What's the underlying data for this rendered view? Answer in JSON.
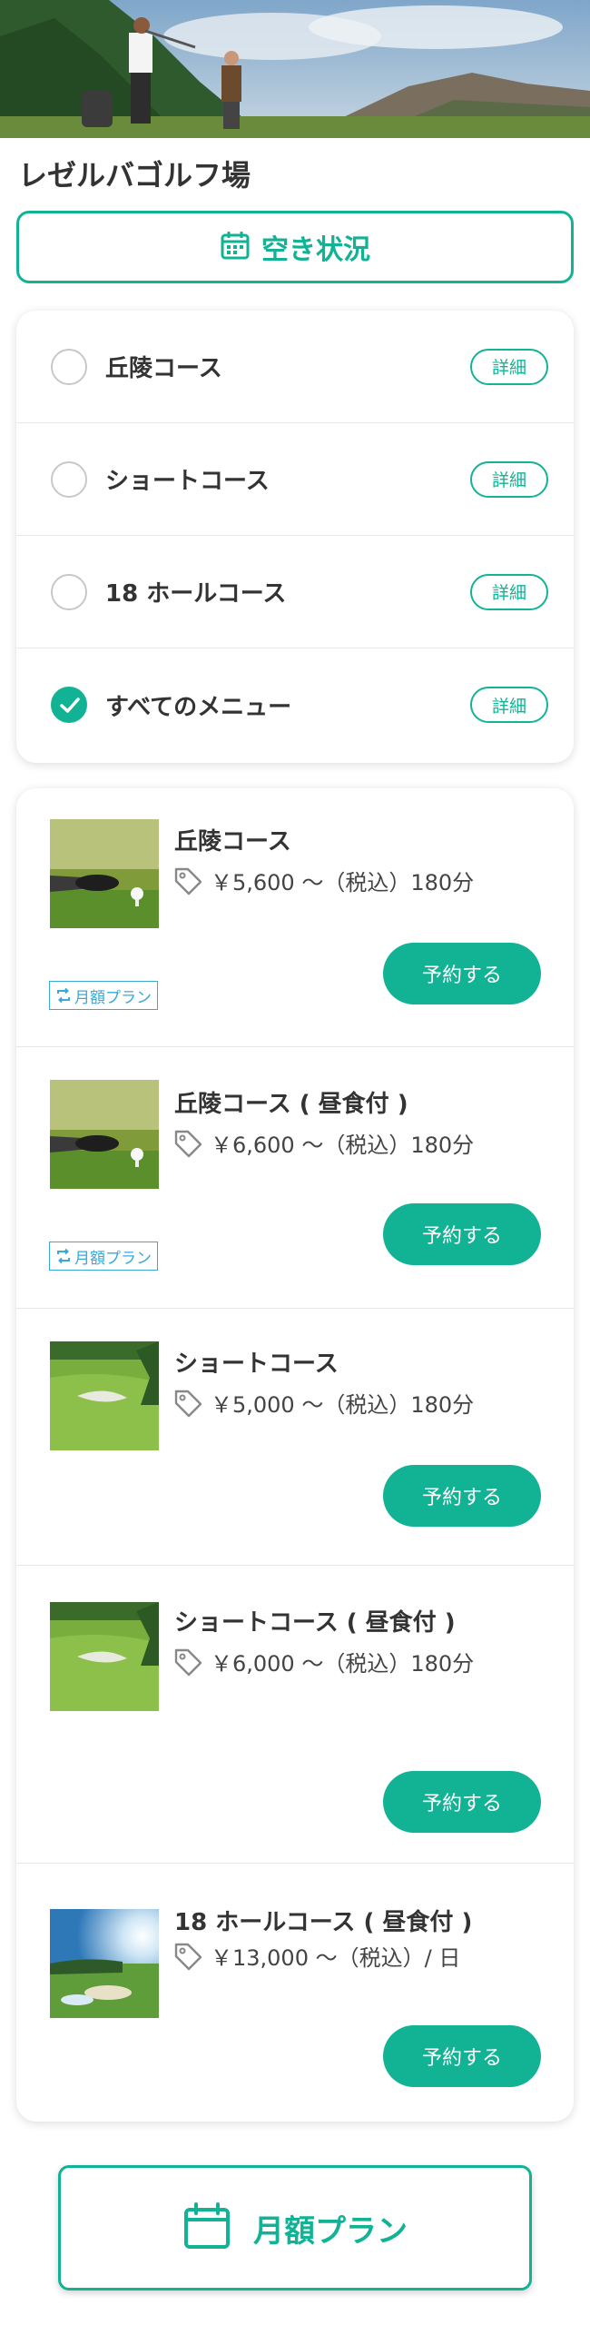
{
  "venue": {
    "title": "レゼルバゴルフ場"
  },
  "availability_button": {
    "label": "空き状況",
    "icon": "calendar-icon"
  },
  "course_filter": {
    "options": [
      {
        "label": "丘陵コース",
        "checked": false,
        "detail_label": "詳細"
      },
      {
        "label": "ショートコース",
        "checked": false,
        "detail_label": "詳細"
      },
      {
        "label": "18 ホールコース",
        "checked": false,
        "detail_label": "詳細"
      },
      {
        "label": "すべてのメニュー",
        "checked": true,
        "detail_label": "詳細"
      }
    ]
  },
  "plans": [
    {
      "name": "丘陵コース",
      "price": "￥5,600 〜（税込）180分",
      "reserve_label": "予約する",
      "badge": "月額プラン",
      "thumbnail": "golf-ball-tee"
    },
    {
      "name": "丘陵コース ( 昼食付 )",
      "price": "￥6,600 〜（税込）180分",
      "reserve_label": "予約する",
      "badge": "月額プラン",
      "thumbnail": "golf-ball-tee"
    },
    {
      "name": "ショートコース",
      "price": "￥5,000 〜（税込）180分",
      "reserve_label": "予約する",
      "badge": "",
      "thumbnail": "fairway"
    },
    {
      "name": "ショートコース ( 昼食付 )",
      "price": "￥6,000 〜（税込）180分",
      "reserve_label": "予約する",
      "badge": "",
      "thumbnail": "fairway"
    },
    {
      "name": "18 ホールコース ( 昼食付 )",
      "price": "￥13,000 〜（税込）/ 日",
      "reserve_label": "予約する",
      "badge": "",
      "thumbnail": "sunny-course"
    }
  ],
  "monthly_plan_button": {
    "label": "月額プラン",
    "icon": "calendar-icon"
  },
  "colors": {
    "accent": "#12b394",
    "badge": "#3aa8d8",
    "text": "#333333",
    "border": "#e6e6e6"
  }
}
